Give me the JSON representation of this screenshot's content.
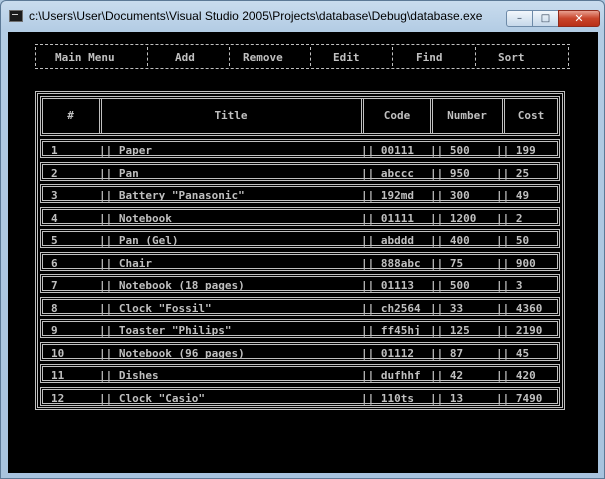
{
  "window": {
    "title": "c:\\Users\\User\\Documents\\Visual Studio 2005\\Projects\\database\\Debug\\database.exe",
    "buttons": {
      "minimize": "–",
      "maximize": "□",
      "close": "✕"
    }
  },
  "menu": {
    "items": [
      "Main Menu",
      "Add",
      "Remove",
      "Edit",
      "Find",
      "Sort"
    ]
  },
  "table": {
    "headers": [
      "#",
      "Title",
      "Code",
      "Number",
      "Cost"
    ],
    "rows": [
      {
        "n": "1",
        "title": "|| Paper",
        "code": "|| 00111",
        "number": "|| 500",
        "cost": "|| 199"
      },
      {
        "n": "2",
        "title": "|| Pan",
        "code": "|| abccc",
        "number": "|| 950",
        "cost": "|| 25"
      },
      {
        "n": "3",
        "title": "|| Battery \"Panasonic\"",
        "code": "|| 192md",
        "number": "|| 300",
        "cost": "|| 49"
      },
      {
        "n": "4",
        "title": "|| Notebook",
        "code": "|| 01111",
        "number": "|| 1200",
        "cost": "|| 2"
      },
      {
        "n": "5",
        "title": "|| Pan (Gel)",
        "code": "|| abddd",
        "number": "|| 400",
        "cost": "|| 50"
      },
      {
        "n": "6",
        "title": "|| Chair",
        "code": "|| 888abc",
        "number": "|| 75",
        "cost": "|| 900"
      },
      {
        "n": "7",
        "title": "|| Notebook (18 pages)",
        "code": "|| 01113",
        "number": "|| 500",
        "cost": "|| 3"
      },
      {
        "n": "8",
        "title": "|| Clock \"Fossil\"",
        "code": "|| ch2564",
        "number": "|| 33",
        "cost": "|| 4360"
      },
      {
        "n": "9",
        "title": "|| Toaster \"Philips\"",
        "code": "|| ff45hj",
        "number": "|| 125",
        "cost": "|| 2190"
      },
      {
        "n": "10",
        "title": "|| Notebook (96 pages)",
        "code": "|| 01112",
        "number": "|| 87",
        "cost": "|| 45"
      },
      {
        "n": "11",
        "title": "|| Dishes",
        "code": "|| dufhhf",
        "number": "|| 42",
        "cost": "|| 420"
      },
      {
        "n": "12",
        "title": "|| Clock \"Casio\"",
        "code": "|| 110ts",
        "number": "|| 13",
        "cost": "|| 7490"
      }
    ]
  }
}
